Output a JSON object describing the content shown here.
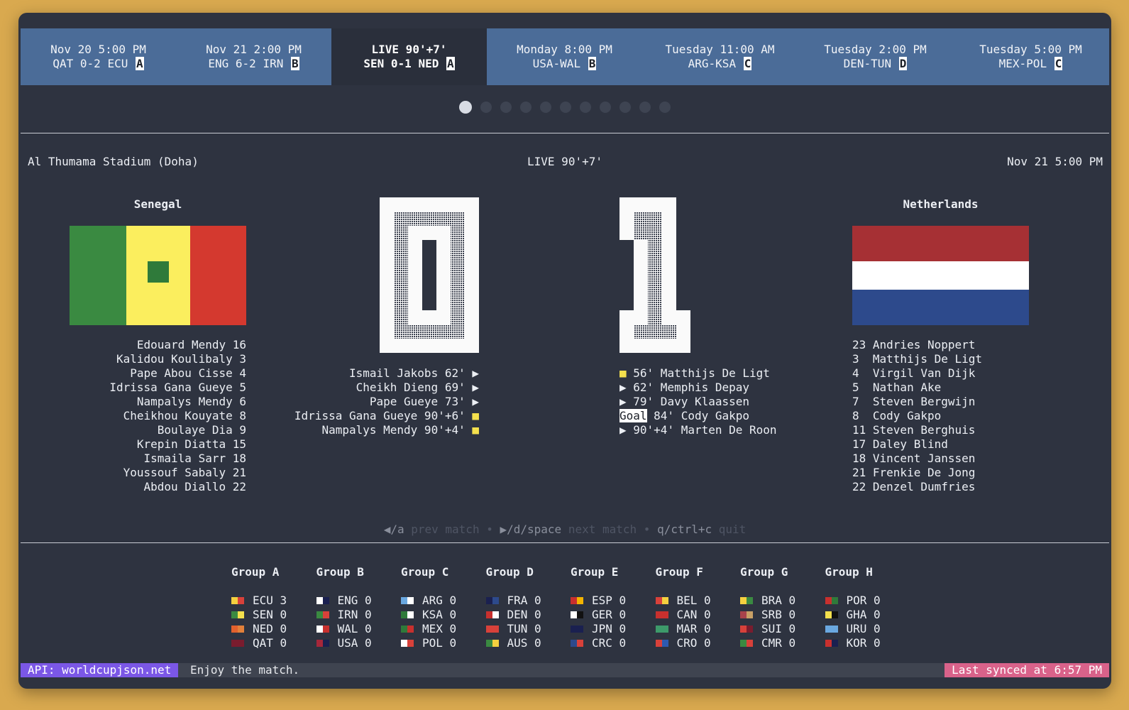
{
  "ticker": [
    {
      "line1": "Nov 20 5:00 PM",
      "line2": "QAT 0-2 ECU",
      "group": "A",
      "active": false
    },
    {
      "line1": "Nov 21 2:00 PM",
      "line2": "ENG 6-2 IRN",
      "group": "B",
      "active": false
    },
    {
      "line1": "LIVE 90'+7'",
      "line2": "SEN 0-1 NED",
      "group": "A",
      "active": true
    },
    {
      "line1": "Monday 8:00 PM",
      "line2": "USA-WAL",
      "group": "B",
      "active": false
    },
    {
      "line1": "Tuesday 11:00 AM",
      "line2": "ARG-KSA",
      "group": "C",
      "active": false
    },
    {
      "line1": "Tuesday 2:00 PM",
      "line2": "DEN-TUN",
      "group": "D",
      "active": false
    },
    {
      "line1": "Tuesday 5:00 PM",
      "line2": "MEX-POL",
      "group": "C",
      "active": false
    }
  ],
  "pager": {
    "total": 11,
    "current": 1
  },
  "match": {
    "venue": "Al Thumama Stadium (Doha)",
    "status": "LIVE 90'+7'",
    "datetime": "Nov 21 5:00 PM",
    "home": {
      "name": "Senegal",
      "score": 0,
      "flag_colors": [
        "#3a8a41",
        "#fbee5e",
        "#d4392f",
        "#2f7a3a"
      ],
      "lineup": [
        "Edouard Mendy 16",
        "Kalidou Koulibaly 3",
        "Pape Abou Cisse 4",
        "Idrissa Gana Gueye 5",
        "Nampalys Mendy 6",
        "Cheikhou Kouyate 8",
        "Boulaye Dia 9",
        "Krepin Diatta 15",
        "Ismaila Sarr 18",
        "Youssouf Sabaly 21",
        "Abdou Diallo 22"
      ],
      "events": [
        {
          "text": "Ismail Jakobs 62'",
          "mark": "▶",
          "type": "sub"
        },
        {
          "text": "Cheikh Dieng 69'",
          "mark": "▶",
          "type": "sub"
        },
        {
          "text": "Pape Gueye 73'",
          "mark": "▶",
          "type": "sub"
        },
        {
          "text": "Idrissa Gana Gueye 90'+6'",
          "mark": "■",
          "type": "card"
        },
        {
          "text": "Nampalys Mendy 90'+4'",
          "mark": "■",
          "type": "card"
        }
      ]
    },
    "away": {
      "name": "Netherlands",
      "score": 1,
      "flag_colors": [
        "#a63034",
        "#ffffff",
        "#2d4a8c"
      ],
      "lineup": [
        "23 Andries Noppert",
        "3  Matthijs De Ligt",
        "4  Virgil Van Dijk",
        "5  Nathan Ake",
        "7  Steven Bergwijn",
        "8  Cody Gakpo",
        "11 Steven Berghuis",
        "17 Daley Blind",
        "18 Vincent Janssen",
        "21 Frenkie De Jong",
        "22 Denzel Dumfries"
      ],
      "events": [
        {
          "mark": "■",
          "text": " 56' Matthijs De Ligt",
          "type": "card"
        },
        {
          "mark": "▶",
          "text": " 62' Memphis Depay",
          "type": "sub"
        },
        {
          "mark": "▶",
          "text": " 79' Davy Klaassen",
          "type": "sub"
        },
        {
          "mark": "Goal",
          "text": " 84' Cody Gakpo",
          "type": "goal"
        },
        {
          "mark": "▶",
          "text": " 90'+4' Marten De Roon",
          "type": "sub"
        }
      ]
    }
  },
  "help": {
    "k1": "◀/a",
    "d1": " prev match",
    "sep": " • ",
    "k2": "▶/d/space",
    "d2": " next match",
    "k3": "q/ctrl+c",
    "d3": " quit"
  },
  "groups": [
    {
      "name": "Group A",
      "teams": [
        {
          "t": "ECU 3",
          "c": [
            "#f4d03f",
            "#d8413a"
          ]
        },
        {
          "t": "SEN 0",
          "c": [
            "#3a8a41",
            "#f4e04d"
          ]
        },
        {
          "t": "NED 0",
          "c": [
            "#e2612d",
            "#e2803a"
          ]
        },
        {
          "t": "QAT 0",
          "c": [
            "#7a1c2e",
            "#7a1c2e"
          ]
        }
      ]
    },
    {
      "name": "Group B",
      "teams": [
        {
          "t": "ENG 0",
          "c": [
            "#ffffff",
            "#1a2050"
          ]
        },
        {
          "t": "IRN 0",
          "c": [
            "#3a8a41",
            "#d8413a"
          ]
        },
        {
          "t": "WAL 0",
          "c": [
            "#ffffff",
            "#c8302e"
          ]
        },
        {
          "t": "USA 0",
          "c": [
            "#a6273a",
            "#1a2050"
          ]
        }
      ]
    },
    {
      "name": "Group C",
      "teams": [
        {
          "t": "ARG 0",
          "c": [
            "#6aa8e0",
            "#ffffff"
          ]
        },
        {
          "t": "KSA 0",
          "c": [
            "#2f7a3a",
            "#ffffff"
          ]
        },
        {
          "t": "MEX 0",
          "c": [
            "#2f7a3a",
            "#c8302e"
          ]
        },
        {
          "t": "POL 0",
          "c": [
            "#ffffff",
            "#d8413a"
          ]
        }
      ]
    },
    {
      "name": "Group D",
      "teams": [
        {
          "t": "FRA 0",
          "c": [
            "#1a2050",
            "#2d4a8c"
          ]
        },
        {
          "t": "DEN 0",
          "c": [
            "#c8302e",
            "#ffffff"
          ]
        },
        {
          "t": "TUN 0",
          "c": [
            "#d8413a",
            "#d8413a"
          ]
        },
        {
          "t": "AUS 0",
          "c": [
            "#3a8a41",
            "#f4d03f"
          ]
        }
      ]
    },
    {
      "name": "Group E",
      "teams": [
        {
          "t": "ESP 0",
          "c": [
            "#c8302e",
            "#f4b400"
          ]
        },
        {
          "t": "GER 0",
          "c": [
            "#ffffff",
            "#111111"
          ]
        },
        {
          "t": "JPN 0",
          "c": [
            "#1a2050",
            "#1a2050"
          ]
        },
        {
          "t": "CRC 0",
          "c": [
            "#2d4a8c",
            "#d8413a"
          ]
        }
      ]
    },
    {
      "name": "Group F",
      "teams": [
        {
          "t": "BEL 0",
          "c": [
            "#d8413a",
            "#f4d03f"
          ]
        },
        {
          "t": "CAN 0",
          "c": [
            "#c8302e",
            "#c8302e"
          ]
        },
        {
          "t": "MAR 0",
          "c": [
            "#3d9a6a",
            "#3d9a6a"
          ]
        },
        {
          "t": "CRO 0",
          "c": [
            "#d8413a",
            "#2d5ab0"
          ]
        }
      ]
    },
    {
      "name": "Group G",
      "teams": [
        {
          "t": "BRA 0",
          "c": [
            "#f4d03f",
            "#3a8a41"
          ]
        },
        {
          "t": "SRB 0",
          "c": [
            "#a8434b",
            "#c8a066"
          ]
        },
        {
          "t": "SUI 0",
          "c": [
            "#d8413a",
            "#7a1c2e"
          ]
        },
        {
          "t": "CMR 0",
          "c": [
            "#3a8a41",
            "#d8413a"
          ]
        }
      ]
    },
    {
      "name": "Group H",
      "teams": [
        {
          "t": "POR 0",
          "c": [
            "#c8302e",
            "#2f7a3a"
          ]
        },
        {
          "t": "GHA 0",
          "c": [
            "#f4e04d",
            "#111111"
          ]
        },
        {
          "t": "URU 0",
          "c": [
            "#6aa8e0",
            "#6aa8e0"
          ]
        },
        {
          "t": "KOR 0",
          "c": [
            "#c8302e",
            "#1a2050"
          ]
        }
      ]
    }
  ],
  "status": {
    "api": "API: worldcupjson.net",
    "message": "Enjoy the match.",
    "synced": "Last synced at 6:57 PM"
  }
}
